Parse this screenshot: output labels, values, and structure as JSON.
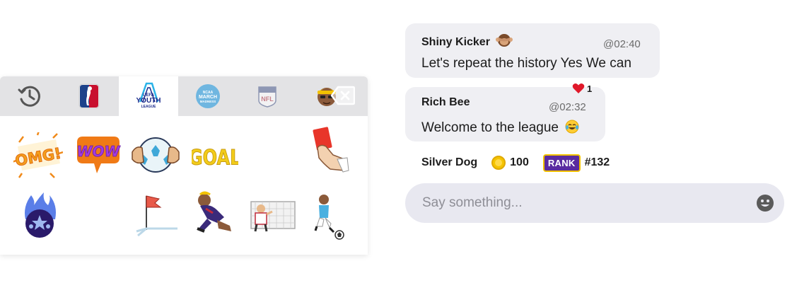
{
  "sticker_panel": {
    "tabs": [
      {
        "id": "recent",
        "icon": "clock-icon",
        "active": false
      },
      {
        "id": "nba",
        "icon": "nba-logo-icon",
        "active": false
      },
      {
        "id": "uefa-youth",
        "icon": "uefa-youth-league-logo",
        "active": true,
        "logo_lines": [
          "UEFA",
          "YOUTH",
          "LEAGUE"
        ]
      },
      {
        "id": "ncaa",
        "icon": "ncaa-march-madness-logo",
        "active": false,
        "logo_lines": [
          "NCAA",
          "MARCH",
          "MADNESS"
        ]
      },
      {
        "id": "nfl",
        "icon": "nfl-logo-icon",
        "active": false,
        "logo_lines": [
          "NFL"
        ]
      },
      {
        "id": "character",
        "icon": "player-face-icon",
        "active": false
      }
    ],
    "backspace_icon": "backspace-icon",
    "stickers": [
      {
        "name": "omg-sticker",
        "text": "OMG!"
      },
      {
        "name": "wow-sticker",
        "text": "WOW"
      },
      {
        "name": "soccer-ball-hands-sticker"
      },
      {
        "name": "goal-sticker",
        "text": "GOAL"
      },
      {
        "name": "red-card-sticker"
      },
      {
        "name": "flaming-ball-sticker"
      },
      {
        "name": "corner-flag-sticker"
      },
      {
        "name": "player-slide-sticker"
      },
      {
        "name": "goalkeeper-net-sticker"
      },
      {
        "name": "player-kick-sticker"
      }
    ]
  },
  "chat": {
    "messages": [
      {
        "author": "Shiny Kicker",
        "author_icon": "see-no-evil-monkey-icon",
        "time": "@02:40",
        "text": "Let's repeat the history Yes We can"
      },
      {
        "author": "Rich Bee",
        "time": "@02:32",
        "text": "Welcome to the league",
        "text_icon": "laughing-tears-emoji-icon",
        "reaction": {
          "icon": "heart-icon",
          "count": "1"
        }
      }
    ],
    "current_user": {
      "name": "Silver Dog",
      "coins": "100",
      "rank_label": "RANK",
      "rank": "#132"
    },
    "input": {
      "placeholder": "Say something...",
      "value": ""
    },
    "emoji_button_icon": "smiley-icon",
    "colors": {
      "bubble": "#efeff3",
      "rank_badge": "#5a2ca0",
      "coin": "#f5c400",
      "heart": "#e0192a"
    }
  }
}
